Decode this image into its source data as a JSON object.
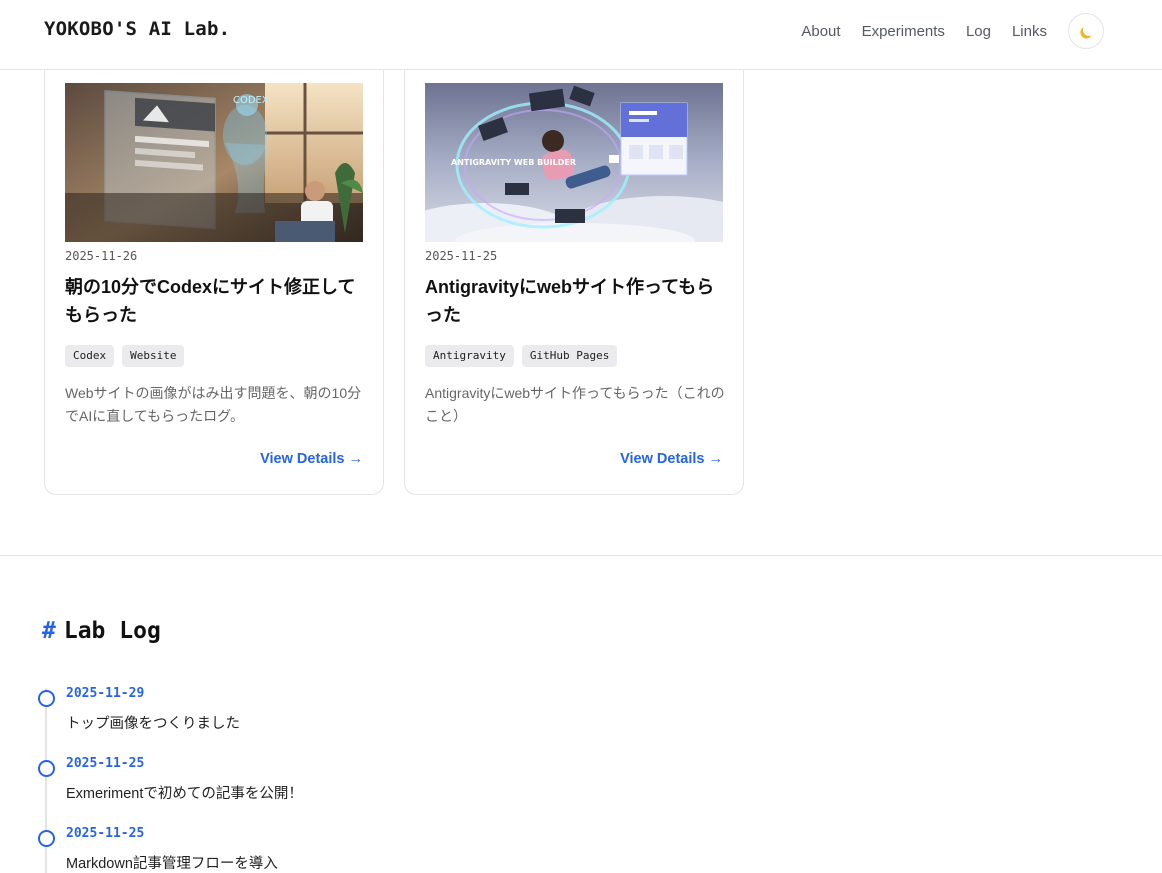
{
  "header": {
    "logo": "YOKOBO'S AI Lab.",
    "nav": [
      "About",
      "Experiments",
      "Log",
      "Links"
    ],
    "theme_toggle_icon": "moon-icon"
  },
  "cards": [
    {
      "date": "2025-11-26",
      "title": "朝の10分でCodexにサイト修正してもらった",
      "tags": [
        "Codex",
        "Website"
      ],
      "description": "Webサイトの画像がはみ出す問題を、朝の10分でAIに直してもらったログ。",
      "link": "View Details →",
      "image_text": "CODEX"
    },
    {
      "date": "2025-11-25",
      "title": "Antigravityにwebサイト作ってもらった",
      "tags": [
        "Antigravity",
        "GitHub Pages"
      ],
      "description": "Antigravityにwebサイト作ってもらった（これのこと）",
      "link": "View Details →",
      "image_text": "ANTIGRAVITY WEB BUILDER"
    }
  ],
  "lab_log": {
    "hash": "#",
    "title": "Lab Log",
    "entries": [
      {
        "date": "2025-11-29",
        "text": "トップ画像をつくりました"
      },
      {
        "date": "2025-11-25",
        "text": "Exmerimentで初めての記事を公開！"
      },
      {
        "date": "2025-11-25",
        "text": "Markdown記事管理フローを導入"
      }
    ]
  },
  "colors": {
    "accent": "#2563eb",
    "border": "#e4e4e7",
    "moon": "#f0b429"
  }
}
